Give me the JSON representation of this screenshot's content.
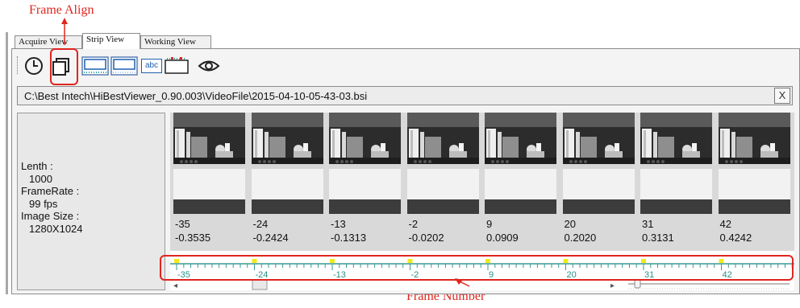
{
  "annotations": {
    "frame_align": "Frame Align",
    "frame_number": "Frame Number",
    "color": "#e0251f"
  },
  "tabs": [
    {
      "label": "Acquire View",
      "active": false
    },
    {
      "label": "Strip View",
      "active": true
    },
    {
      "label": "Working View",
      "active": false
    }
  ],
  "toolbar": {
    "icons": [
      "clock-icon",
      "frame-align-icon",
      "strip-layout-icon",
      "strip-layout-alt-icon",
      "text-label-icon",
      "ruler-icon",
      "eye-icon"
    ],
    "text_icon_label": "abc"
  },
  "path_bar": {
    "path": "C:\\Best Intech\\HiBestViewer_0.90.003\\VideoFile\\2015-04-10-05-43-03.bsi",
    "close_label": "X"
  },
  "info": {
    "length_label": "Lenth :",
    "length_value": "1000",
    "framerate_label": "FrameRate :",
    "framerate_value": "99 fps",
    "size_label": "Image Size :",
    "size_value": "1280X1024"
  },
  "frames": [
    {
      "number": "-35",
      "time": "-0.3535"
    },
    {
      "number": "-24",
      "time": "-0.2424"
    },
    {
      "number": "-13",
      "time": "-0.1313"
    },
    {
      "number": "-2",
      "time": "-0.0202"
    },
    {
      "number": "9",
      "time": "0.0909"
    },
    {
      "number": "20",
      "time": "0.2020"
    },
    {
      "number": "31",
      "time": "0.3131"
    },
    {
      "number": "42",
      "time": "0.4242"
    }
  ],
  "ruler": {
    "labels": [
      "-35",
      "-24",
      "-13",
      "-2",
      "9",
      "20",
      "31",
      "42"
    ],
    "tick_color": "#3a9a92",
    "marker_color": "#f3ea1a"
  },
  "scrollbar": {
    "left_arrow": "◂",
    "right_arrow": "▸"
  }
}
